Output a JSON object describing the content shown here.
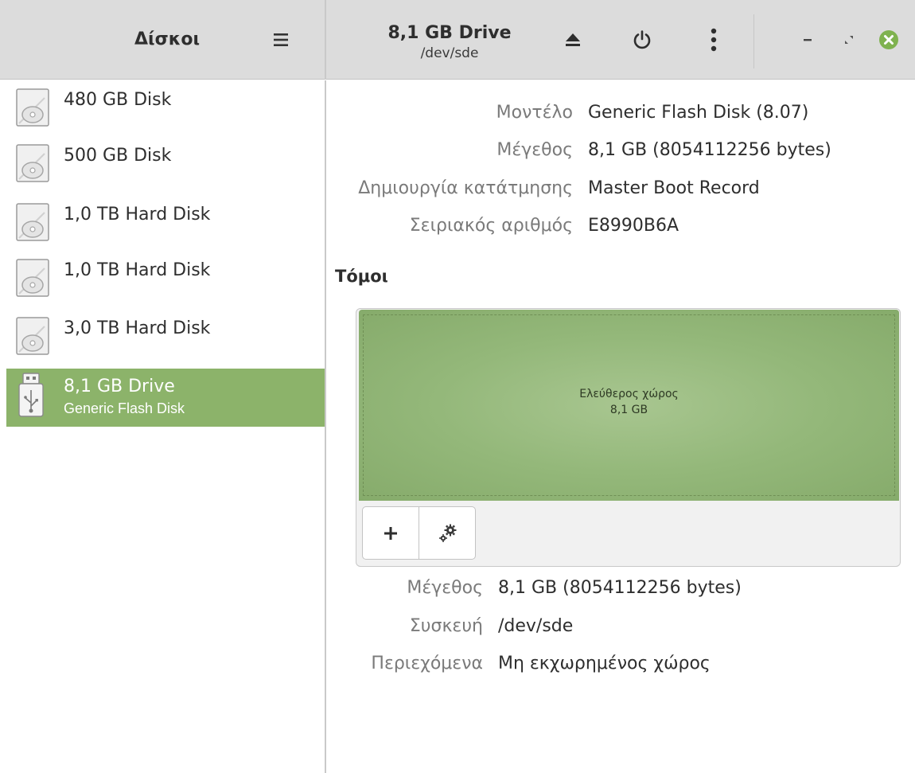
{
  "sidebar": {
    "title": "Δίσκοι",
    "disks": [
      {
        "name": "480 GB Disk",
        "icon": "hard-disk-icon"
      },
      {
        "name": "500 GB Disk",
        "icon": "hard-disk-icon"
      },
      {
        "name": "1,0 TB Hard Disk",
        "icon": "hard-disk-icon"
      },
      {
        "name": "1,0 TB Hard Disk",
        "icon": "hard-disk-icon"
      },
      {
        "name": "3,0 TB Hard Disk",
        "icon": "hard-disk-icon"
      },
      {
        "name": "8,1 GB Drive",
        "subtitle": "Generic Flash Disk",
        "icon": "usb-drive-icon",
        "selected": true
      }
    ]
  },
  "header": {
    "title": "8,1 GB Drive",
    "subtitle": "/dev/sde"
  },
  "drive_info": {
    "model_label": "Μοντέλο",
    "model_value": "Generic Flash Disk (8.07)",
    "size_label": "Μέγεθος",
    "size_value": "8,1 GB (8054112256 bytes)",
    "partitioning_label": "Δημιουργία κατάτμησης",
    "partitioning_value": "Master Boot Record",
    "serial_label": "Σειριακός αριθμός",
    "serial_value": "E8990B6A"
  },
  "volumes": {
    "title": "Τόμοι",
    "segment_name": "Ελεύθερος χώρος",
    "segment_size": "8,1 GB"
  },
  "volume_info": {
    "size_label": "Μέγεθος",
    "size_value": "8,1 GB (8054112256 bytes)",
    "device_label": "Συσκευή",
    "device_value": "/dev/sde",
    "contents_label": "Περιεχόμενα",
    "contents_value": "Μη εκχωρημένος χώρος"
  },
  "colors": {
    "accent": "#8cb36a",
    "close_button": "#7fb24f",
    "header_bg": "#dcdcdc"
  }
}
